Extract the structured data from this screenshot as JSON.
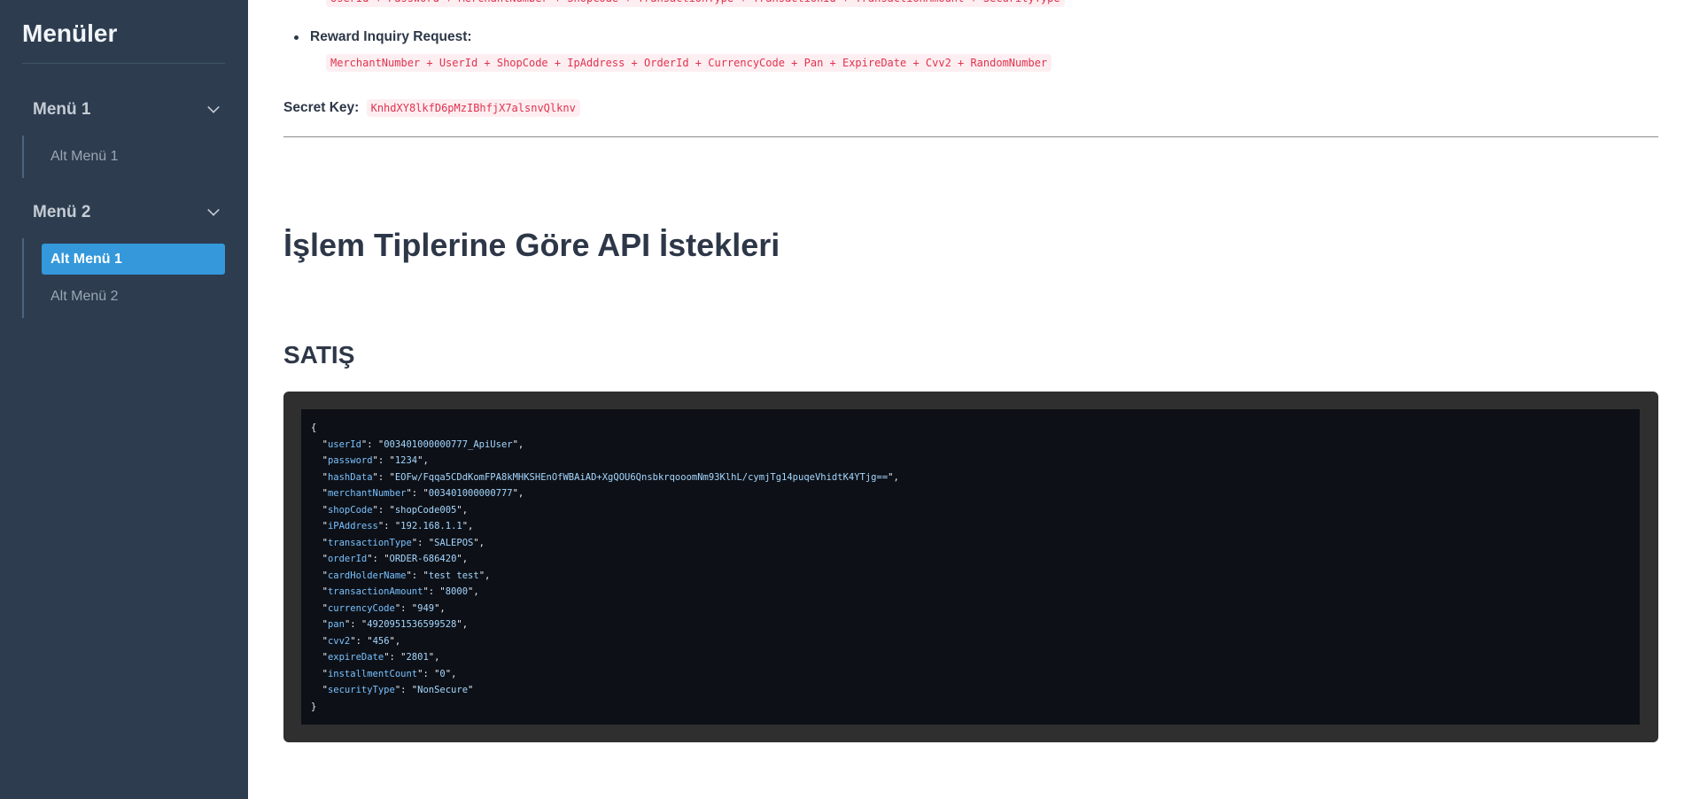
{
  "sidebar": {
    "title": "Menüler",
    "menus": [
      {
        "label": "Menü 1",
        "items": [
          {
            "label": "Alt Menü 1",
            "active": false
          }
        ]
      },
      {
        "label": "Menü 2",
        "items": [
          {
            "label": "Alt Menü 1",
            "active": true
          },
          {
            "label": "Alt Menü 2",
            "active": false
          }
        ]
      }
    ]
  },
  "content": {
    "prev_hash_formula": "UserId + Password + MerchantNumber + ShopCode + TransactionType + TransactionId + TransactionAmount + SecurityType",
    "reward_label": "Reward Inquiry Request:",
    "reward_formula": "MerchantNumber + UserId + ShopCode + IpAddress + OrderId + CurrencyCode + Pan + ExpireDate + Cvv2 + RandomNumber",
    "secret_label": "Secret Key:",
    "secret_value": "KnhdXY8lkfD6pMzIBhfjX7alsnvQlknv",
    "heading": "İşlem Tiplerine Göre API İstekleri",
    "subheading": "SATIŞ",
    "code": {
      "open": "{",
      "close": "}",
      "fields": [
        [
          "userId",
          "003401000000777_ApiUser"
        ],
        [
          "password",
          "1234"
        ],
        [
          "hashData",
          "EOFw/Fqqa5CDdKomFPA8kMHKSHEnOfWBAiAD+XgQOU6QnsbkrqooomNm93KlhL/cymjTg14puqeVhidtK4YTjg=="
        ],
        [
          "merchantNumber",
          "003401000000777"
        ],
        [
          "shopCode",
          "shopCode005"
        ],
        [
          "iPAddress",
          "192.168.1.1"
        ],
        [
          "transactionType",
          "SALEPOS"
        ],
        [
          "orderId",
          "ORDER-686420"
        ],
        [
          "cardHolderName",
          "test test"
        ],
        [
          "transactionAmount",
          "8000"
        ],
        [
          "currencyCode",
          "949"
        ],
        [
          "pan",
          "4920951536599528"
        ],
        [
          "cvv2",
          "456"
        ],
        [
          "expireDate",
          "2801"
        ],
        [
          "installmentCount",
          "0"
        ],
        [
          "securityType",
          "NonSecure"
        ]
      ]
    }
  }
}
